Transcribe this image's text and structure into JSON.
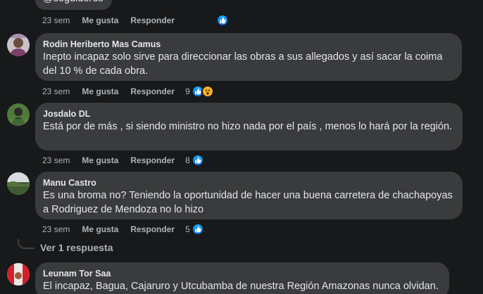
{
  "top_partial": {
    "text": "@seguidores",
    "meta": {
      "time": "23 sem",
      "like": "Me gusta",
      "reply": "Responder"
    }
  },
  "comments": [
    {
      "author": "Rodin Heriberto Mas Camus",
      "text": "Inepto incapaz solo sirve para direccionar las obras a sus allegados y así sacar la coima del 10 % de cada obra.",
      "time": "23 sem",
      "like": "Me gusta",
      "reply": "Responder",
      "reaction_count": "9",
      "reactions": [
        "like-icon",
        "wow-icon"
      ]
    },
    {
      "author": "Josdalo DL",
      "text": "Está por de más , si siendo ministro no hizo nada por el país , menos lo hará por la región.",
      "time": "23 sem",
      "like": "Me gusta",
      "reply": "Responder",
      "reaction_count": "8",
      "reactions": [
        "like-icon"
      ]
    },
    {
      "author": "Manu Castro",
      "text": "Es una broma no? Teniendo la oportunidad de hacer una buena carretera de chachapoyas a Rodriguez de Mendoza no lo hizo",
      "time": "23 sem",
      "like": "Me gusta",
      "reply": "Responder",
      "reaction_count": "5",
      "reactions": [
        "like-icon"
      ]
    },
    {
      "author": "Leunam Tor Saa",
      "text": "El incapaz, Bagua, Cajaruro y Utcubamba de nuestra Región Amazonas nunca olvidan."
    }
  ],
  "view_replies": "Ver 1 respuesta",
  "colors": {
    "background": "#18191a",
    "bubble": "#3a3b3c",
    "text": "#e4e6eb",
    "secondary_text": "#b0b3b8",
    "like_blue": "#1877f2",
    "wow_yellow": "#f7b125"
  }
}
